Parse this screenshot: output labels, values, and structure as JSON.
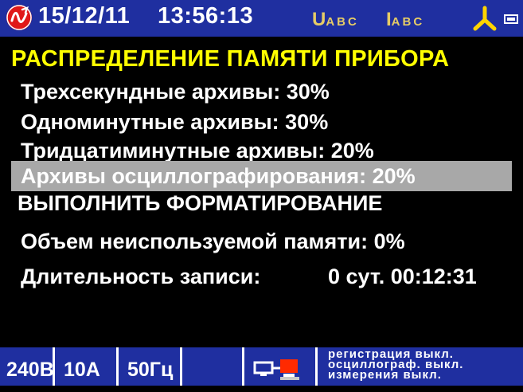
{
  "status_bar": {
    "date": "15/12/11",
    "time": "13:56:13",
    "voltage_indicator": "U",
    "voltage_indicator_sub": "ABC",
    "current_indicator": "I",
    "current_indicator_sub": "ABC",
    "icons": [
      "logo-icon",
      "phase-star-icon",
      "battery-icon"
    ]
  },
  "menu": {
    "title": "РАСПРЕДЕЛЕНИЕ ПАМЯТИ ПРИБОРА",
    "items": [
      {
        "label": "Трехсекундные архивы: 30%"
      },
      {
        "label": "Одноминутные архивы: 30%"
      },
      {
        "label": "Тридцатиминутные архивы: 20%"
      },
      {
        "label": "Архивы осциллографирования: 20%",
        "selected": true
      },
      {
        "label": "ВЫПОЛНИТЬ ФОРМАТИРОВАНИЕ"
      }
    ]
  },
  "info": {
    "unused_memory": "Объем неиспользуемой памяти: 0%",
    "record_duration_label": "Длительность записи:",
    "record_duration_value": "0 сут. 00:12:31"
  },
  "bottom_bar": {
    "voltage": "240В",
    "current": "10А",
    "frequency": "50Гц",
    "status_lines": [
      "регистрация выкл.",
      "осциллограф. выкл.",
      "измерения выкл."
    ]
  },
  "colors": {
    "bar_background": "#1f2fa0",
    "title": "#ffff00",
    "selected_row": "#a8a8a8",
    "indicator": "#e6cc66",
    "logo": "#e01818"
  }
}
